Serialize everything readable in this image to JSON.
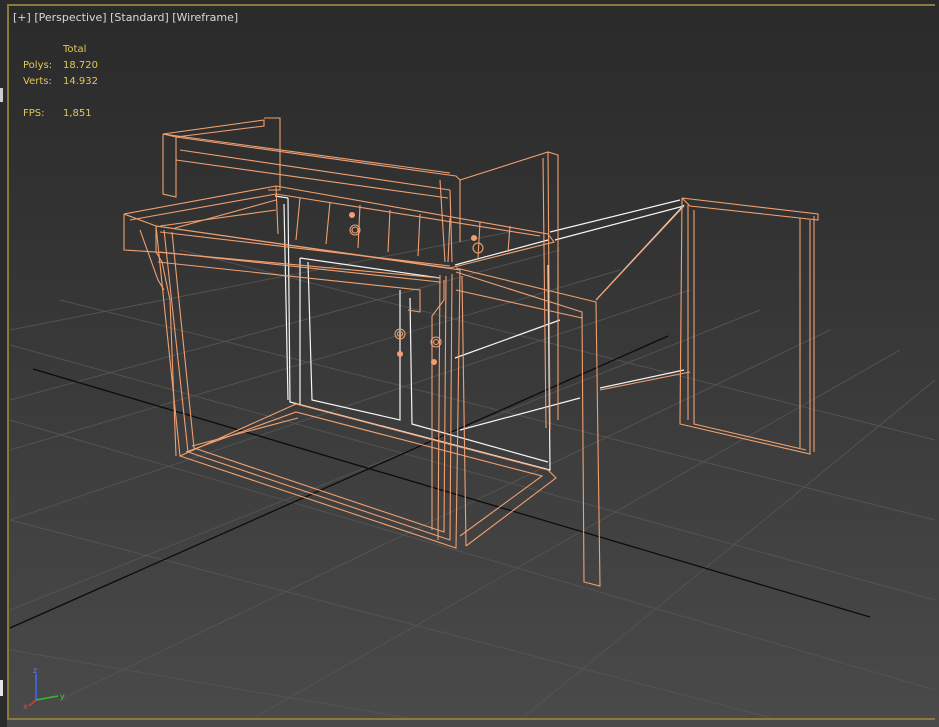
{
  "viewport": {
    "labels": {
      "plus": "[+]",
      "view": "[Perspective]",
      "shading": "[Standard]",
      "mode": "[Wireframe]"
    },
    "stats": {
      "header": "Total",
      "polys_label": "Polys:",
      "polys_value": "18.720",
      "verts_label": "Verts:",
      "verts_value": "14.932",
      "fps_label": "FPS:",
      "fps_value": "1,851"
    },
    "axis_gizmo": {
      "z": "z",
      "x": "x",
      "y": "y"
    },
    "colors": {
      "border": "#8a7a40",
      "stats_text": "#e0c85a",
      "wire_orange": "#f0a070",
      "wire_white": "#f4f4f4",
      "grid": "#5a5a5a"
    }
  }
}
